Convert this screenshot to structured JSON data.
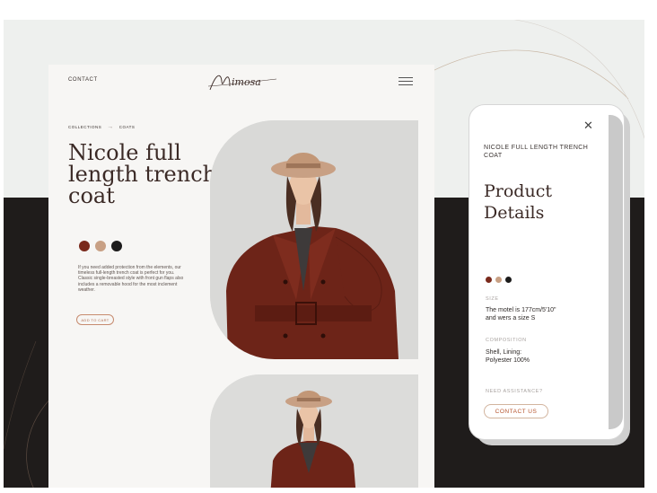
{
  "colors": {
    "accent": "#b5532c",
    "coat": "#6d2418",
    "swatch_rust": "#7a2a1c",
    "swatch_tan": "#c8a084",
    "swatch_black": "#1c1b1b"
  },
  "site": {
    "nav": {
      "contact_label": "CONTACT",
      "logo_text": "Mimosa",
      "menu_icon": "hamburger-icon"
    },
    "breadcrumb": {
      "items": [
        "COLLECTIONS",
        "COATS"
      ],
      "separator": "→"
    },
    "product_title": "Nicole full length trench coat",
    "swatches": [
      "#7a2a1c",
      "#c8a084",
      "#1c1b1b"
    ],
    "description": "If you need added protection from the elements, our timeless full-length trench coat is perfect for you. Classic single-breasted style with front gun flaps also includes a removable hood for the most inclement weather.",
    "add_to_cart_label": "ADD TO CART"
  },
  "phone": {
    "close_icon": "close-icon",
    "subtitle": "NICOLE FULL LENGTH TRENCH COAT",
    "title_line1": "Product",
    "title_line2": "Details",
    "swatches": [
      "#7a2a1c",
      "#c8a084",
      "#1c1b1b"
    ],
    "size_label": "SIZE",
    "size_text_line1": "The motel is 177cm/5'10\"",
    "size_text_line2": "and wers a size S",
    "composition_label": "COMPOSITION",
    "composition_line1": "Shell, Lining:",
    "composition_line2": "Polyester 100%",
    "assistance_label": "NEED ASSISTANCE?",
    "contact_label": "CONTACT US"
  }
}
